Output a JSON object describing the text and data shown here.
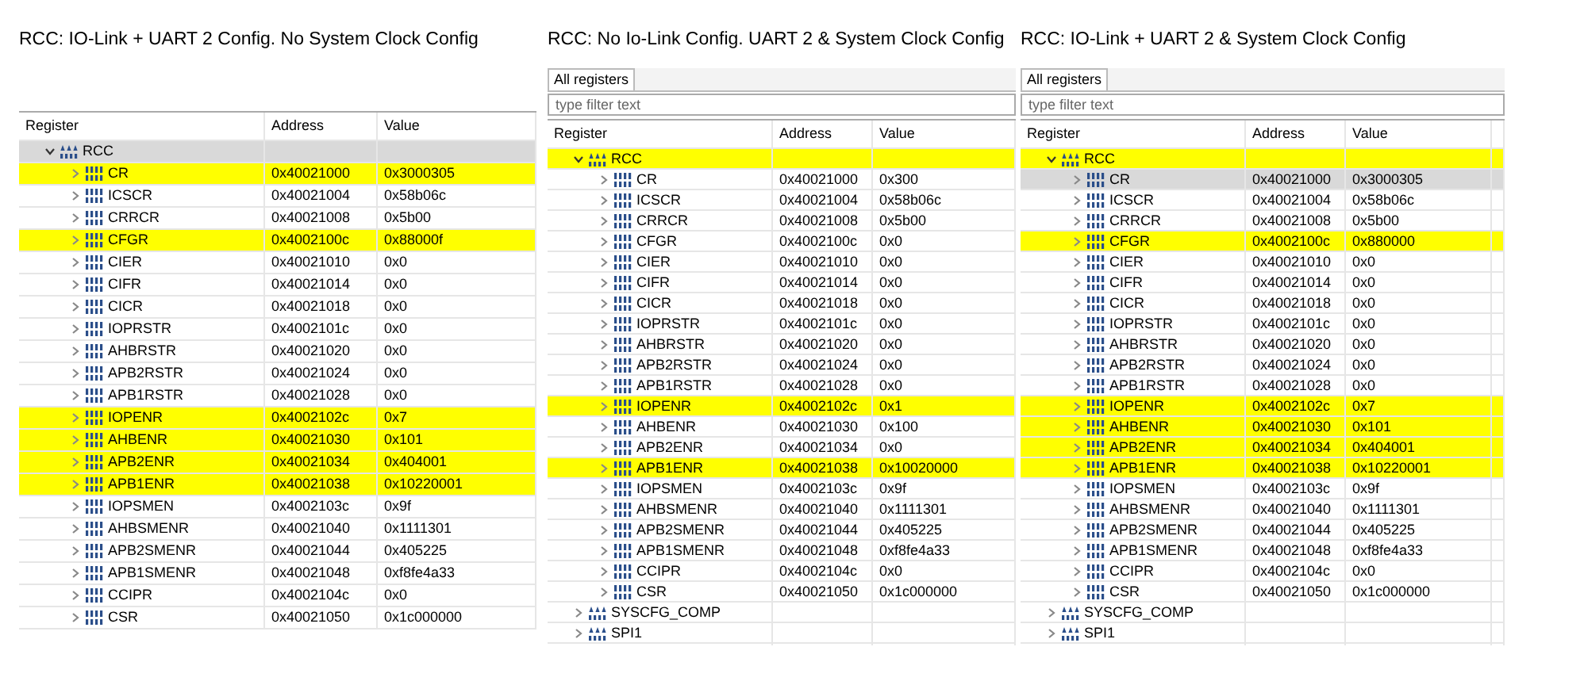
{
  "panels": [
    {
      "title": "RCC: IO-Link + UART 2 Config. No System Clock Config",
      "columns": [
        "Register",
        "Address",
        "Value"
      ],
      "rows": [
        {
          "kind": "peripheral",
          "name": "RCC",
          "expanded": true,
          "selected": true,
          "highlighted": false,
          "children": [
            {
              "kind": "register",
              "name": "CR",
              "address": "0x40021000",
              "value": "0x3000305",
              "expanded": false,
              "selected": false,
              "highlighted": true
            },
            {
              "kind": "register",
              "name": "ICSCR",
              "address": "0x40021004",
              "value": "0x58b06c",
              "expanded": false,
              "selected": false,
              "highlighted": false
            },
            {
              "kind": "register",
              "name": "CRRCR",
              "address": "0x40021008",
              "value": "0x5b00",
              "expanded": false,
              "selected": false,
              "highlighted": false
            },
            {
              "kind": "register",
              "name": "CFGR",
              "address": "0x4002100c",
              "value": "0x88000f",
              "expanded": false,
              "selected": false,
              "highlighted": true
            },
            {
              "kind": "register",
              "name": "CIER",
              "address": "0x40021010",
              "value": "0x0",
              "expanded": false,
              "selected": false,
              "highlighted": false
            },
            {
              "kind": "register",
              "name": "CIFR",
              "address": "0x40021014",
              "value": "0x0",
              "expanded": false,
              "selected": false,
              "highlighted": false
            },
            {
              "kind": "register",
              "name": "CICR",
              "address": "0x40021018",
              "value": "0x0",
              "expanded": false,
              "selected": false,
              "highlighted": false
            },
            {
              "kind": "register",
              "name": "IOPRSTR",
              "address": "0x4002101c",
              "value": "0x0",
              "expanded": false,
              "selected": false,
              "highlighted": false
            },
            {
              "kind": "register",
              "name": "AHBRSTR",
              "address": "0x40021020",
              "value": "0x0",
              "expanded": false,
              "selected": false,
              "highlighted": false
            },
            {
              "kind": "register",
              "name": "APB2RSTR",
              "address": "0x40021024",
              "value": "0x0",
              "expanded": false,
              "selected": false,
              "highlighted": false
            },
            {
              "kind": "register",
              "name": "APB1RSTR",
              "address": "0x40021028",
              "value": "0x0",
              "expanded": false,
              "selected": false,
              "highlighted": false
            },
            {
              "kind": "register",
              "name": "IOPENR",
              "address": "0x4002102c",
              "value": "0x7",
              "expanded": false,
              "selected": false,
              "highlighted": true
            },
            {
              "kind": "register",
              "name": "AHBENR",
              "address": "0x40021030",
              "value": "0x101",
              "expanded": false,
              "selected": false,
              "highlighted": true
            },
            {
              "kind": "register",
              "name": "APB2ENR",
              "address": "0x40021034",
              "value": "0x404001",
              "expanded": false,
              "selected": false,
              "highlighted": true
            },
            {
              "kind": "register",
              "name": "APB1ENR",
              "address": "0x40021038",
              "value": "0x10220001",
              "expanded": false,
              "selected": false,
              "highlighted": true
            },
            {
              "kind": "register",
              "name": "IOPSMEN",
              "address": "0x4002103c",
              "value": "0x9f",
              "expanded": false,
              "selected": false,
              "highlighted": false
            },
            {
              "kind": "register",
              "name": "AHBSMENR",
              "address": "0x40021040",
              "value": "0x1111301",
              "expanded": false,
              "selected": false,
              "highlighted": false
            },
            {
              "kind": "register",
              "name": "APB2SMENR",
              "address": "0x40021044",
              "value": "0x405225",
              "expanded": false,
              "selected": false,
              "highlighted": false
            },
            {
              "kind": "register",
              "name": "APB1SMENR",
              "address": "0x40021048",
              "value": "0xf8fe4a33",
              "expanded": false,
              "selected": false,
              "highlighted": false
            },
            {
              "kind": "register",
              "name": "CCIPR",
              "address": "0x4002104c",
              "value": "0x0",
              "expanded": false,
              "selected": false,
              "highlighted": false
            },
            {
              "kind": "register",
              "name": "CSR",
              "address": "0x40021050",
              "value": "0x1c000000",
              "expanded": false,
              "selected": false,
              "highlighted": false
            }
          ]
        }
      ]
    },
    {
      "title": "RCC: No Io-Link Config. UART 2 & System Clock Config",
      "tabs": [
        {
          "label": "All registers",
          "selected": true
        }
      ],
      "filter": {
        "placeholder": "type filter text"
      },
      "columns": [
        "Register",
        "Address",
        "Value"
      ],
      "rows": [
        {
          "kind": "peripheral",
          "name": "RCC",
          "expanded": true,
          "selected": false,
          "highlighted": true,
          "children": [
            {
              "kind": "register",
              "name": "CR",
              "address": "0x40021000",
              "value": "0x300",
              "expanded": false,
              "selected": false,
              "highlighted": false
            },
            {
              "kind": "register",
              "name": "ICSCR",
              "address": "0x40021004",
              "value": "0x58b06c",
              "expanded": false,
              "selected": false,
              "highlighted": false
            },
            {
              "kind": "register",
              "name": "CRRCR",
              "address": "0x40021008",
              "value": "0x5b00",
              "expanded": false,
              "selected": false,
              "highlighted": false
            },
            {
              "kind": "register",
              "name": "CFGR",
              "address": "0x4002100c",
              "value": "0x0",
              "expanded": false,
              "selected": false,
              "highlighted": false
            },
            {
              "kind": "register",
              "name": "CIER",
              "address": "0x40021010",
              "value": "0x0",
              "expanded": false,
              "selected": false,
              "highlighted": false
            },
            {
              "kind": "register",
              "name": "CIFR",
              "address": "0x40021014",
              "value": "0x0",
              "expanded": false,
              "selected": false,
              "highlighted": false
            },
            {
              "kind": "register",
              "name": "CICR",
              "address": "0x40021018",
              "value": "0x0",
              "expanded": false,
              "selected": false,
              "highlighted": false
            },
            {
              "kind": "register",
              "name": "IOPRSTR",
              "address": "0x4002101c",
              "value": "0x0",
              "expanded": false,
              "selected": false,
              "highlighted": false
            },
            {
              "kind": "register",
              "name": "AHBRSTR",
              "address": "0x40021020",
              "value": "0x0",
              "expanded": false,
              "selected": false,
              "highlighted": false
            },
            {
              "kind": "register",
              "name": "APB2RSTR",
              "address": "0x40021024",
              "value": "0x0",
              "expanded": false,
              "selected": false,
              "highlighted": false
            },
            {
              "kind": "register",
              "name": "APB1RSTR",
              "address": "0x40021028",
              "value": "0x0",
              "expanded": false,
              "selected": false,
              "highlighted": false
            },
            {
              "kind": "register",
              "name": "IOPENR",
              "address": "0x4002102c",
              "value": "0x1",
              "expanded": false,
              "selected": false,
              "highlighted": true
            },
            {
              "kind": "register",
              "name": "AHBENR",
              "address": "0x40021030",
              "value": "0x100",
              "expanded": false,
              "selected": false,
              "highlighted": false
            },
            {
              "kind": "register",
              "name": "APB2ENR",
              "address": "0x40021034",
              "value": "0x0",
              "expanded": false,
              "selected": false,
              "highlighted": false
            },
            {
              "kind": "register",
              "name": "APB1ENR",
              "address": "0x40021038",
              "value": "0x10020000",
              "expanded": false,
              "selected": false,
              "highlighted": true
            },
            {
              "kind": "register",
              "name": "IOPSMEN",
              "address": "0x4002103c",
              "value": "0x9f",
              "expanded": false,
              "selected": false,
              "highlighted": false
            },
            {
              "kind": "register",
              "name": "AHBSMENR",
              "address": "0x40021040",
              "value": "0x1111301",
              "expanded": false,
              "selected": false,
              "highlighted": false
            },
            {
              "kind": "register",
              "name": "APB2SMENR",
              "address": "0x40021044",
              "value": "0x405225",
              "expanded": false,
              "selected": false,
              "highlighted": false
            },
            {
              "kind": "register",
              "name": "APB1SMENR",
              "address": "0x40021048",
              "value": "0xf8fe4a33",
              "expanded": false,
              "selected": false,
              "highlighted": false
            },
            {
              "kind": "register",
              "name": "CCIPR",
              "address": "0x4002104c",
              "value": "0x0",
              "expanded": false,
              "selected": false,
              "highlighted": false
            },
            {
              "kind": "register",
              "name": "CSR",
              "address": "0x40021050",
              "value": "0x1c000000",
              "expanded": false,
              "selected": false,
              "highlighted": false
            }
          ]
        },
        {
          "kind": "peripheral",
          "name": "SYSCFG_COMP",
          "expanded": false,
          "selected": false,
          "highlighted": false
        },
        {
          "kind": "peripheral",
          "name": "SPI1",
          "expanded": false,
          "selected": false,
          "highlighted": false
        }
      ]
    },
    {
      "title": "RCC: IO-Link + UART 2 & System Clock Config",
      "tabs": [
        {
          "label": "All registers",
          "selected": true
        }
      ],
      "filter": {
        "placeholder": "type filter text"
      },
      "columns": [
        "Register",
        "Address",
        "Value"
      ],
      "rows": [
        {
          "kind": "peripheral",
          "name": "RCC",
          "expanded": true,
          "selected": false,
          "highlighted": true,
          "children": [
            {
              "kind": "register",
              "name": "CR",
              "address": "0x40021000",
              "value": "0x3000305",
              "expanded": false,
              "selected": true,
              "highlighted": false
            },
            {
              "kind": "register",
              "name": "ICSCR",
              "address": "0x40021004",
              "value": "0x58b06c",
              "expanded": false,
              "selected": false,
              "highlighted": false
            },
            {
              "kind": "register",
              "name": "CRRCR",
              "address": "0x40021008",
              "value": "0x5b00",
              "expanded": false,
              "selected": false,
              "highlighted": false
            },
            {
              "kind": "register",
              "name": "CFGR",
              "address": "0x4002100c",
              "value": "0x880000",
              "expanded": false,
              "selected": false,
              "highlighted": true
            },
            {
              "kind": "register",
              "name": "CIER",
              "address": "0x40021010",
              "value": "0x0",
              "expanded": false,
              "selected": false,
              "highlighted": false
            },
            {
              "kind": "register",
              "name": "CIFR",
              "address": "0x40021014",
              "value": "0x0",
              "expanded": false,
              "selected": false,
              "highlighted": false
            },
            {
              "kind": "register",
              "name": "CICR",
              "address": "0x40021018",
              "value": "0x0",
              "expanded": false,
              "selected": false,
              "highlighted": false
            },
            {
              "kind": "register",
              "name": "IOPRSTR",
              "address": "0x4002101c",
              "value": "0x0",
              "expanded": false,
              "selected": false,
              "highlighted": false
            },
            {
              "kind": "register",
              "name": "AHBRSTR",
              "address": "0x40021020",
              "value": "0x0",
              "expanded": false,
              "selected": false,
              "highlighted": false
            },
            {
              "kind": "register",
              "name": "APB2RSTR",
              "address": "0x40021024",
              "value": "0x0",
              "expanded": false,
              "selected": false,
              "highlighted": false
            },
            {
              "kind": "register",
              "name": "APB1RSTR",
              "address": "0x40021028",
              "value": "0x0",
              "expanded": false,
              "selected": false,
              "highlighted": false
            },
            {
              "kind": "register",
              "name": "IOPENR",
              "address": "0x4002102c",
              "value": "0x7",
              "expanded": false,
              "selected": false,
              "highlighted": true
            },
            {
              "kind": "register",
              "name": "AHBENR",
              "address": "0x40021030",
              "value": "0x101",
              "expanded": false,
              "selected": false,
              "highlighted": true
            },
            {
              "kind": "register",
              "name": "APB2ENR",
              "address": "0x40021034",
              "value": "0x404001",
              "expanded": false,
              "selected": false,
              "highlighted": true
            },
            {
              "kind": "register",
              "name": "APB1ENR",
              "address": "0x40021038",
              "value": "0x10220001",
              "expanded": false,
              "selected": false,
              "highlighted": true
            },
            {
              "kind": "register",
              "name": "IOPSMEN",
              "address": "0x4002103c",
              "value": "0x9f",
              "expanded": false,
              "selected": false,
              "highlighted": false
            },
            {
              "kind": "register",
              "name": "AHBSMENR",
              "address": "0x40021040",
              "value": "0x1111301",
              "expanded": false,
              "selected": false,
              "highlighted": false
            },
            {
              "kind": "register",
              "name": "APB2SMENR",
              "address": "0x40021044",
              "value": "0x405225",
              "expanded": false,
              "selected": false,
              "highlighted": false
            },
            {
              "kind": "register",
              "name": "APB1SMENR",
              "address": "0x40021048",
              "value": "0xf8fe4a33",
              "expanded": false,
              "selected": false,
              "highlighted": false
            },
            {
              "kind": "register",
              "name": "CCIPR",
              "address": "0x4002104c",
              "value": "0x0",
              "expanded": false,
              "selected": false,
              "highlighted": false
            },
            {
              "kind": "register",
              "name": "CSR",
              "address": "0x40021050",
              "value": "0x1c000000",
              "expanded": false,
              "selected": false,
              "highlighted": false
            }
          ]
        },
        {
          "kind": "peripheral",
          "name": "SYSCFG_COMP",
          "expanded": false,
          "selected": false,
          "highlighted": false
        },
        {
          "kind": "peripheral",
          "name": "SPI1",
          "expanded": false,
          "selected": false,
          "highlighted": false
        }
      ]
    }
  ]
}
